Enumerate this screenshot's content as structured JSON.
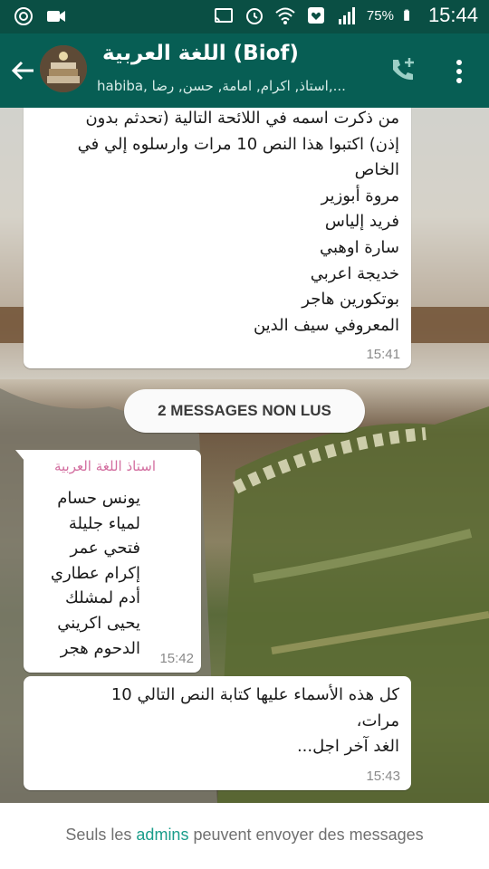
{
  "status_bar": {
    "battery_percent": "75%",
    "time": "15:44"
  },
  "header": {
    "title": "اللغة العربية (Biof)",
    "participants": "habiba, استاذ, اكرام, امامة, حسن, رضا,..."
  },
  "messages": [
    {
      "lines": [
        "من ذكرت اسمه في اللائحة التالية (تحدثم بدون",
        "إذن) اكتبوا هذا النص 10 مرات وارسلوه إلي في",
        "الخاص",
        "مروة أبوزير",
        "فريد إلياس",
        "سارة اوهبي",
        "خديجة اعربي",
        "بوتكورين هاجر",
        "المعروفي سيف الدين"
      ],
      "time": "15:41"
    },
    {
      "sender": "استاذ اللغة العربية",
      "lines": [
        "يونس حسام",
        "لمياء جليلة",
        "فتحي عمر",
        "إكرام عطاري",
        "أدم لمشلك",
        "يحيى اكريني",
        "الدحوم هجر"
      ],
      "time": "15:42"
    },
    {
      "lines": [
        "كل هذه الأسماء عليها كتابة النص التالي 10",
        "مرات،",
        "الغد آخر اجل..."
      ],
      "time": "15:43"
    }
  ],
  "unread_banner": "2 MESSAGES NON LUS",
  "footer": {
    "before": "Seuls les ",
    "link": "admins",
    "after": " peuvent envoyer des messages"
  },
  "colors": {
    "status_bar": "#0a4f44",
    "app_bar": "#075e54",
    "sender_name": "#d36fa0",
    "admins_link": "#199d8a"
  },
  "icons": [
    "whatsapp-status-icon",
    "video-camera-icon",
    "cast-icon",
    "alarm-icon",
    "wifi-icon",
    "notification-icon",
    "signal-icon",
    "battery-icon",
    "back-arrow-icon",
    "add-call-icon",
    "more-options-icon"
  ]
}
